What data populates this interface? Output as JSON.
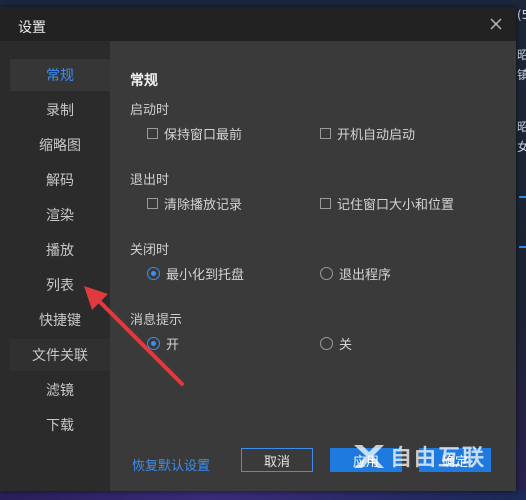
{
  "dialog": {
    "title": "设置",
    "close_icon": "close-icon"
  },
  "sidebar": {
    "items": [
      {
        "label": "常规",
        "active": true
      },
      {
        "label": "录制",
        "active": false
      },
      {
        "label": "缩略图",
        "active": false
      },
      {
        "label": "解码",
        "active": false
      },
      {
        "label": "渲染",
        "active": false
      },
      {
        "label": "播放",
        "active": false
      },
      {
        "label": "列表",
        "active": false
      },
      {
        "label": "快捷键",
        "active": false
      },
      {
        "label": "文件关联",
        "active": false
      },
      {
        "label": "滤镜",
        "active": false
      },
      {
        "label": "下载",
        "active": false
      }
    ]
  },
  "content": {
    "heading": "常规",
    "groups": {
      "startup": {
        "title": "启动时",
        "options": [
          {
            "label": "保持窗口最前",
            "checked": false
          },
          {
            "label": "开机自动启动",
            "checked": false
          }
        ]
      },
      "exit": {
        "title": "退出时",
        "options": [
          {
            "label": "清除播放记录",
            "checked": false
          },
          {
            "label": "记住窗口大小和位置",
            "checked": false
          }
        ]
      },
      "close": {
        "title": "关闭时",
        "options": [
          {
            "label": "最小化到托盘",
            "selected": true
          },
          {
            "label": "退出程序",
            "selected": false
          }
        ]
      },
      "notify": {
        "title": "消息提示",
        "options": [
          {
            "label": "开",
            "selected": true
          },
          {
            "label": "关",
            "selected": false
          }
        ]
      }
    }
  },
  "footer": {
    "reset_label": "恢复默认设置",
    "cancel_label": "取消",
    "apply_label": "应用",
    "ok_label": "确定"
  },
  "background": {
    "right_glyphs": [
      "(5",
      "昭",
      "镇",
      "昭",
      "女"
    ]
  },
  "watermark": {
    "text": "自由互联",
    "logo_icon": "x-logo-icon"
  },
  "colors": {
    "accent": "#3d8ef0",
    "button_primary": "#1f7ae0",
    "dialog_bg": "#2b2b2b",
    "content_bg": "#3a3a3a",
    "annotation_arrow": "#e0393e"
  }
}
